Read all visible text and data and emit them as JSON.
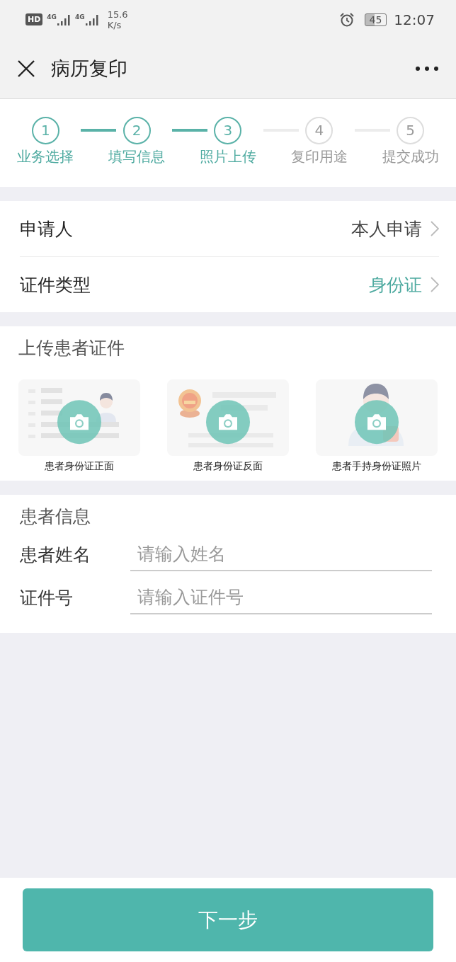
{
  "status_bar": {
    "hd": "HD",
    "sim1": "4G",
    "sim2": "4G",
    "speed_value": "15.6",
    "speed_unit": "K/s",
    "battery": "45",
    "time": "12:07"
  },
  "nav": {
    "title": "病历复印"
  },
  "steps": [
    {
      "number": "1",
      "label": "业务选择",
      "done": true
    },
    {
      "number": "2",
      "label": "填写信息",
      "done": true
    },
    {
      "number": "3",
      "label": "照片上传",
      "done": true
    },
    {
      "number": "4",
      "label": "复印用途",
      "done": false
    },
    {
      "number": "5",
      "label": "提交成功",
      "done": false
    }
  ],
  "form": [
    {
      "label": "申请人",
      "value": "本人申请",
      "highlighted": false
    },
    {
      "label": "证件类型",
      "value": "身份证",
      "highlighted": true
    }
  ],
  "upload": {
    "title": "上传患者证件",
    "cards": [
      {
        "kind": "front",
        "caption": "患者身份证正面"
      },
      {
        "kind": "back",
        "caption": "患者身份证反面"
      },
      {
        "kind": "holding",
        "caption": "患者手持身份证照片"
      }
    ]
  },
  "patient": {
    "title": "患者信息",
    "fields": [
      {
        "label": "患者姓名",
        "placeholder": "请输入姓名"
      },
      {
        "label": "证件号",
        "placeholder": "请输入证件号"
      }
    ]
  },
  "next_button": "下一步"
}
